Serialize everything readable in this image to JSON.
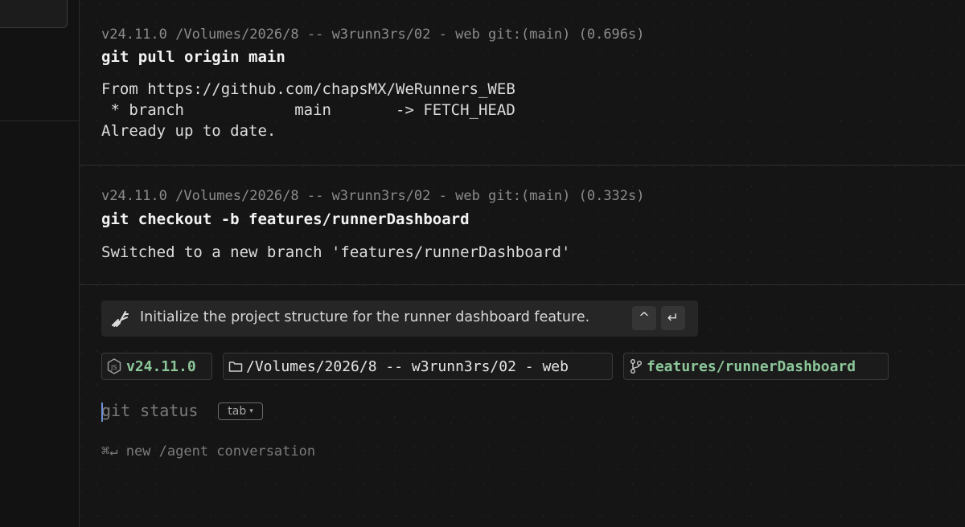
{
  "blocks": [
    {
      "meta": "v24.11.0 /Volumes/2026/8 -- w3runn3rs/02 - web git:(main) (0.696s)",
      "command": "git pull origin main",
      "output": [
        "From https://github.com/chapsMX/WeRunners_WEB",
        " * branch            main       -> FETCH_HEAD",
        "Already up to date."
      ]
    },
    {
      "meta": "v24.11.0 /Volumes/2026/8 -- w3runn3rs/02 - web git:(main) (0.332s)",
      "command": "git checkout -b features/runnerDashboard",
      "output": [
        "Switched to a new branch 'features/runnerDashboard'"
      ]
    }
  ],
  "agent_suggestion": {
    "icon": "agent-sparkle-icon",
    "text": "Initialize the project structure for the runner dashboard feature.",
    "up_key": "^",
    "enter_key": "↵"
  },
  "context_chips": {
    "node": {
      "icon": "nodejs-icon",
      "label": "v24.11.0",
      "color": "#8cc79a"
    },
    "dir": {
      "icon": "folder-icon",
      "label": "/Volumes/2026/8 -- w3runn3rs/02 - web",
      "color": "#e6e6e6"
    },
    "branch": {
      "icon": "git-branch-icon",
      "label": "features/runnerDashboard",
      "color": "#8cc79a"
    }
  },
  "prompt": {
    "hint": "git status",
    "tab_label": "tab",
    "tab_caret": "▾"
  },
  "shortcut_hint": "⌘↵ new /agent conversation",
  "colors": {
    "background": "#151515",
    "accent_green": "#8cc79a",
    "cursor": "#6f8fd6"
  }
}
